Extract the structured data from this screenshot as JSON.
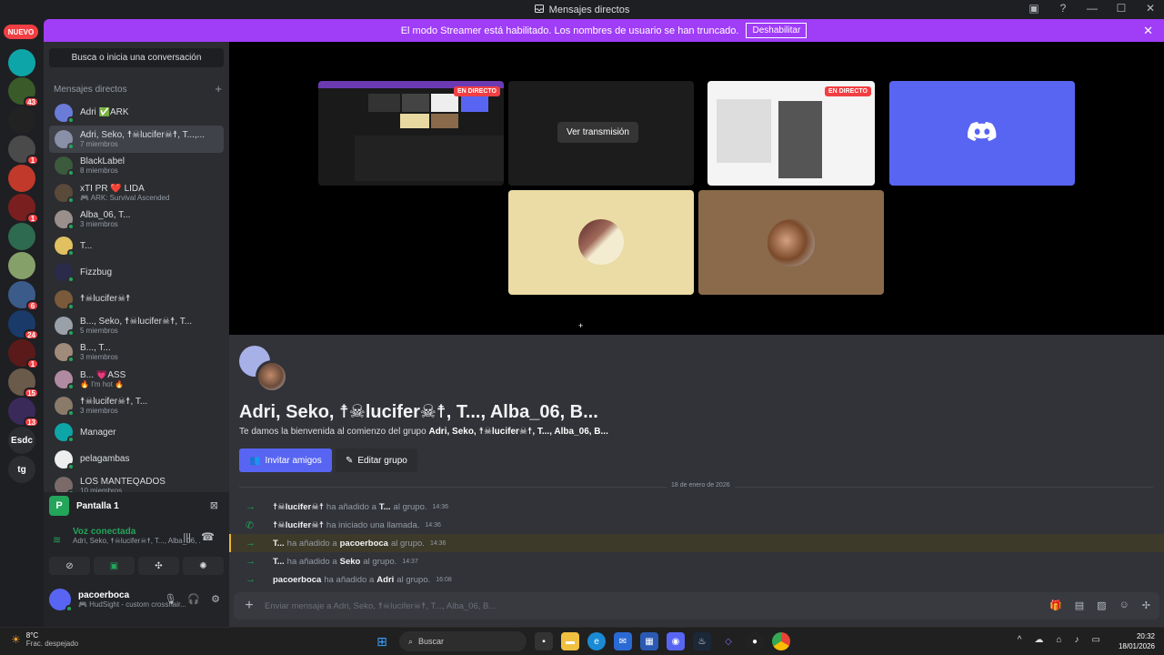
{
  "window": {
    "title": "Mensajes directos"
  },
  "banner": {
    "text": "El modo Streamer está habilitado. Los nombres de usuario se han truncado.",
    "button": "Deshabilitar"
  },
  "rail": {
    "nuevo": "NUEVO",
    "items": [
      {
        "color": "#0ea5a8",
        "label": "",
        "badge": ""
      },
      {
        "color": "#3a5a2a",
        "label": "",
        "badge": "43"
      },
      {
        "color": "#222222",
        "label": "",
        "badge": ""
      },
      {
        "color": "#4a4a4a",
        "label": "",
        "badge": "1"
      },
      {
        "color": "#c0392b",
        "label": "",
        "badge": ""
      },
      {
        "color": "#7a1f1f",
        "label": "",
        "badge": "1"
      },
      {
        "color": "#2d6a4f",
        "label": "",
        "badge": ""
      },
      {
        "color": "#86a06a",
        "label": "",
        "badge": ""
      },
      {
        "color": "#3b5b8a",
        "label": "",
        "badge": "6"
      },
      {
        "color": "#1a3a6a",
        "label": "",
        "badge": "24"
      },
      {
        "color": "#5a1a1a",
        "label": "",
        "badge": "1"
      },
      {
        "color": "#6a5a4a",
        "label": "",
        "badge": "15"
      },
      {
        "color": "#3a2a5a",
        "label": "",
        "badge": "13"
      },
      {
        "color": "#2b2d31",
        "label": "Esdc",
        "badge": ""
      },
      {
        "color": "#2b2d31",
        "label": "tg",
        "badge": ""
      }
    ]
  },
  "sidebar": {
    "search": "Busca o inicia una conversación",
    "header": "Mensajes directos",
    "items": [
      {
        "name": "Adri ✅ARK",
        "sub": "",
        "color": "#6b7bd8"
      },
      {
        "name": "Adri, Seko, ☨☠lucifer☠☨, T...,...",
        "sub": "7 miembros",
        "color": "#8a8fa8"
      },
      {
        "name": "BlackLabel",
        "sub": "8 miembros",
        "color": "#3c5a3c"
      },
      {
        "name": "xTI PR ❤️ LIDA",
        "sub": "🎮 ARK: Survival Ascended",
        "color": "#5a4a3a"
      },
      {
        "name": "Alba_06, T...",
        "sub": "3 miembros",
        "color": "#9a8f8a"
      },
      {
        "name": "T...",
        "sub": "",
        "color": "#e0c060"
      },
      {
        "name": "Fizzbug",
        "sub": "",
        "color": "#2a2a4a"
      },
      {
        "name": "☨☠lucifer☠☨",
        "sub": "",
        "color": "#7a5a3a"
      },
      {
        "name": "B..., Seko, ☨☠lucifer☠☨, T...",
        "sub": "5 miembros",
        "color": "#9aa0a8"
      },
      {
        "name": "B..., T...",
        "sub": "3 miembros",
        "color": "#a08a7a"
      },
      {
        "name": "B... 💗ASS",
        "sub": "🔥 I'm hot 🔥",
        "color": "#b08aa0"
      },
      {
        "name": "☨☠lucifer☠☨, T...",
        "sub": "3 miembros",
        "color": "#8a7a6a"
      },
      {
        "name": "Manager",
        "sub": "",
        "color": "#0ea5a8"
      },
      {
        "name": "pelagambas",
        "sub": "",
        "color": "#eeeeee"
      },
      {
        "name": "LOS MANTEQADOS",
        "sub": "10 miembros",
        "color": "#7a6a6a"
      }
    ]
  },
  "voice": {
    "stream_label": "Pantalla 1",
    "connected": "Voz conectada",
    "channel": "Adri, Seko, ☨☠lucifer☠☨, T..., Alba_06, ...",
    "user": "pacoerboca",
    "status": "🎮 HudSight - custom crosshair..."
  },
  "stage": {
    "live_label": "EN DIRECTO",
    "watch_label": "Ver transmisión"
  },
  "group": {
    "title": "Adri, Seko, ☨☠lucifer☠☨, T..., Alba_06, B...",
    "welcome_prefix": "Te damos la bienvenida al comienzo del grupo",
    "welcome_names": "Adri, Seko, ☨☠lucifer☠☨, T..., Alba_06, B...",
    "invite": "Invitar amigos",
    "edit": "Editar grupo"
  },
  "messages": {
    "date": "18 de enero de 2026",
    "items": [
      {
        "icon": "→",
        "actor": "☨☠lucifer☠☨",
        "mid": "ha añadido a",
        "target": "T...",
        "tail": "al grupo.",
        "time": "14:36",
        "hl": false
      },
      {
        "icon": "✆",
        "actor": "☨☠lucifer☠☨",
        "mid": "ha iniciado una llamada.",
        "target": "",
        "tail": "",
        "time": "14:36",
        "hl": false
      },
      {
        "icon": "→",
        "actor": "T...",
        "mid": "ha añadido a",
        "target": "pacoerboca",
        "tail": "al grupo.",
        "time": "14:36",
        "hl": true
      },
      {
        "icon": "→",
        "actor": "T...",
        "mid": "ha añadido a",
        "target": "Seko",
        "tail": "al grupo.",
        "time": "14:37",
        "hl": false
      },
      {
        "icon": "→",
        "actor": "pacoerboca",
        "mid": "ha añadido a",
        "target": "Adri",
        "tail": "al grupo.",
        "time": "16:08",
        "hl": false
      }
    ]
  },
  "composer": {
    "placeholder": "Enviar mensaje a Adri, Seko, ☨☠lucifer☠☨, T..., Alba_06, B..."
  },
  "taskbar": {
    "temp": "8°C",
    "weather": "Frac. despejado",
    "search": "Buscar",
    "time": "20:32",
    "date": "18/01/2026"
  }
}
